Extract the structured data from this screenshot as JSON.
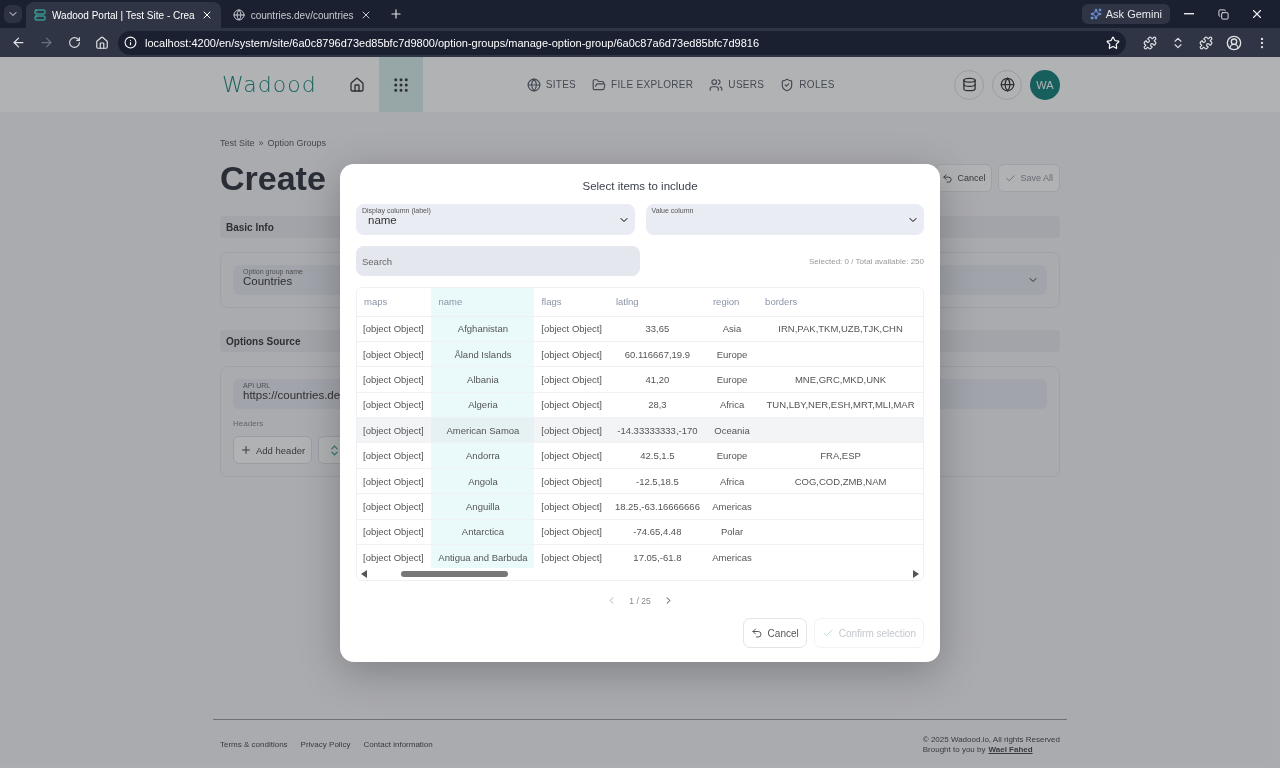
{
  "browser": {
    "tabs": [
      {
        "title": "Wadood Portal | Test Site - Crea",
        "selected": true
      },
      {
        "title": "countries.dev/countries",
        "selected": false
      }
    ],
    "ask_gemini": "Ask Gemini",
    "url": "localhost:4200/en/system/site/6a0c8796d73ed85bfc7d9800/option-groups/manage-option-group/6a0c87a6d73ed85bfc7d9816"
  },
  "header": {
    "logo": "Wadood",
    "apps_button": {
      "active": true
    },
    "nav": [
      {
        "label": "SITES"
      },
      {
        "label": "FILE EXPLORER"
      },
      {
        "label": "USERS"
      },
      {
        "label": "ROLES"
      }
    ],
    "avatar": "WA"
  },
  "page": {
    "breadcrumb": [
      "Test Site",
      "Option Groups"
    ],
    "breadcrumb_separator": "»",
    "title": "Create",
    "actions": [
      {
        "label": "Cancel",
        "kind": "cancel",
        "disabled": false
      },
      {
        "label": "Save All",
        "kind": "save",
        "disabled": true
      }
    ],
    "basic_info": {
      "title": "Basic Info",
      "name_field": {
        "label": "Option group name",
        "value": "Countries"
      }
    },
    "options_source": {
      "title": "Options Source",
      "api_field": {
        "label": "API URL",
        "value": "https://countries.de"
      },
      "headers_label": "Headers",
      "add_header": "Add header"
    }
  },
  "modal": {
    "title": "Select items to include",
    "display_select": {
      "label": "Display column (label)",
      "value": "name"
    },
    "value_select": {
      "label": "Value column"
    },
    "search": {
      "placeholder": "Search"
    },
    "summary": "Selected: 0 / Total available: 250",
    "table": {
      "columns": [
        {
          "label": "maps",
          "highlighted": false
        },
        {
          "label": "name",
          "highlighted": true
        },
        {
          "label": "flags",
          "highlighted": false
        },
        {
          "label": "latlng",
          "highlighted": false
        },
        {
          "label": "region",
          "highlighted": false
        },
        {
          "label": "borders",
          "highlighted": false
        }
      ],
      "rows": [
        {
          "hovered": false,
          "cells": [
            "[object Object]",
            "Afghanistan",
            "[object Object]",
            "33,65",
            "Asia",
            "IRN,PAK,TKM,UZB,TJK,CHN"
          ]
        },
        {
          "hovered": false,
          "cells": [
            "[object Object]",
            "Åland Islands",
            "[object Object]",
            "60.116667,19.9",
            "Europe"
          ]
        },
        {
          "hovered": false,
          "cells": [
            "[object Object]",
            "Albania",
            "[object Object]",
            "41,20",
            "Europe",
            "MNE,GRC,MKD,UNK"
          ]
        },
        {
          "hovered": false,
          "cells": [
            "[object Object]",
            "Algeria",
            "[object Object]",
            "28,3",
            "Africa",
            "TUN,LBY,NER,ESH,MRT,MLI,MAR"
          ]
        },
        {
          "hovered": true,
          "cells": [
            "[object Object]",
            "American Samoa",
            "[object Object]",
            "-14.33333333,-170",
            "Oceania"
          ]
        },
        {
          "hovered": false,
          "cells": [
            "[object Object]",
            "Andorra",
            "[object Object]",
            "42.5,1.5",
            "Europe",
            "FRA,ESP"
          ]
        },
        {
          "hovered": false,
          "cells": [
            "[object Object]",
            "Angola",
            "[object Object]",
            "-12.5,18.5",
            "Africa",
            "COG,COD,ZMB,NAM"
          ]
        },
        {
          "hovered": false,
          "cells": [
            "[object Object]",
            "Anguilla",
            "[object Object]",
            "18.25,-63.16666666",
            "Americas"
          ]
        },
        {
          "hovered": false,
          "cells": [
            "[object Object]",
            "Antarctica",
            "[object Object]",
            "-74.65,4.48",
            "Polar"
          ]
        },
        {
          "hovered": false,
          "cells": [
            "[object Object]",
            "Antigua and Barbuda",
            "[object Object]",
            "17.05,-61.8",
            "Americas"
          ]
        }
      ]
    },
    "pagination": {
      "page": "1 / 25",
      "prev_disabled": true
    },
    "cancel": "Cancel",
    "confirm": {
      "label": "Confirm selection",
      "disabled": true
    }
  },
  "footer": {
    "links": [
      "Terms & conditions",
      "Privacy Policy",
      "Contact information"
    ],
    "copyright": "© 2025 Wadood.io, All rights Reserved",
    "credit": "Brought to you by",
    "credit_link": "Wael Fahed"
  }
}
